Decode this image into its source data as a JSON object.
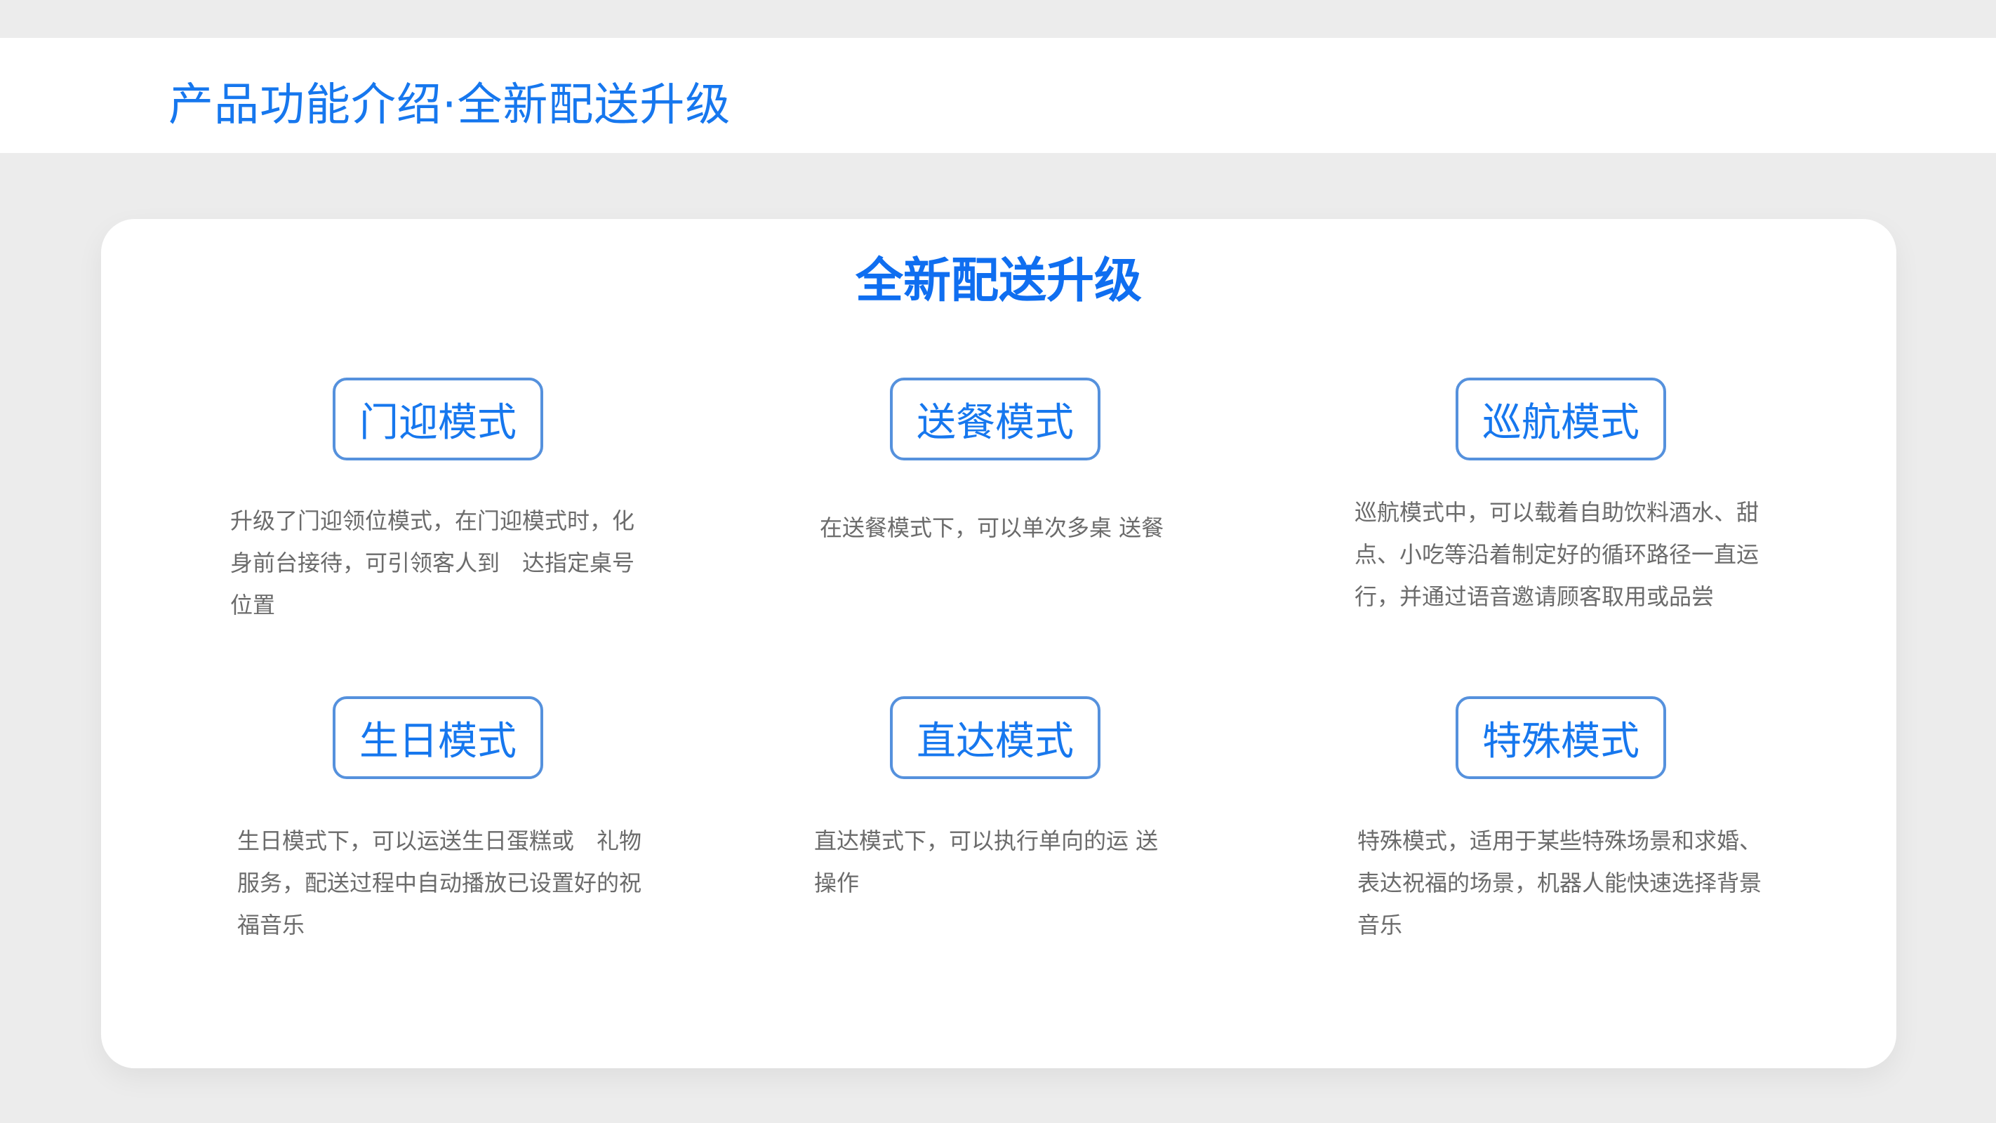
{
  "header": {
    "title": "产品功能介绍·全新配送升级"
  },
  "card": {
    "title": "全新配送升级",
    "modes": [
      {
        "label": "门迎模式",
        "description": "升级了门迎领位模式，在门迎模式时，化身前台接待，可引领客人到　达指定桌号位置"
      },
      {
        "label": "送餐模式",
        "description": "在送餐模式下，可以单次多桌 送餐"
      },
      {
        "label": "巡航模式",
        "description": "巡航模式中，可以载着自助饮料酒水、甜点、小吃等沿着制定好的循环路径一直运行，并通过语音邀请顾客取用或品尝"
      },
      {
        "label": "生日模式",
        "description": "生日模式下，可以运送生日蛋糕或　礼物服务，配送过程中自动播放已设置好的祝福音乐"
      },
      {
        "label": "直达模式",
        "description": "直达模式下，可以执行单向的运 送操作"
      },
      {
        "label": "特殊模式",
        "description": "特殊模式，适用于某些特殊场景和求婚、表达祝福的场景，机器人能快速选择背景音乐"
      }
    ]
  }
}
